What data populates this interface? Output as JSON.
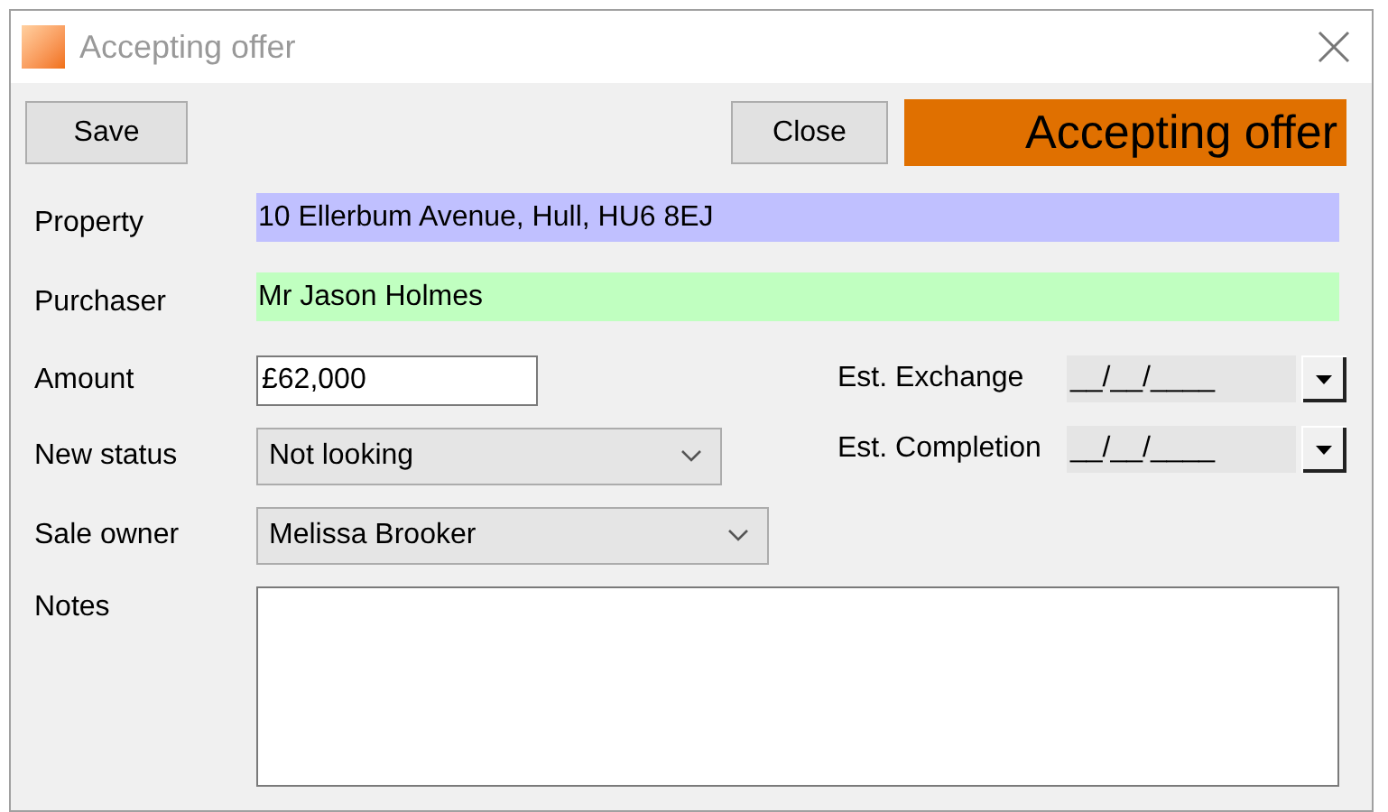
{
  "window": {
    "title": "Accepting offer"
  },
  "buttons": [
    {
      "label": "Save"
    },
    {
      "label": "Close"
    }
  ],
  "status_banner": "Accepting offer",
  "header_fields": [
    {
      "label": "Property",
      "value": "10 Ellerbum Avenue, Hull, HU6 8EJ",
      "color": "#c0c0ff"
    },
    {
      "label": "Purchaser",
      "value": "Mr Jason Holmes",
      "color": "#c0ffc0"
    }
  ],
  "left_fields": [
    {
      "kind": "input",
      "label": "Amount",
      "value": "£62,000"
    },
    {
      "kind": "select",
      "label": "New status",
      "value": "Not looking"
    },
    {
      "kind": "select",
      "label": "Sale owner",
      "value": "Melissa Brooker"
    }
  ],
  "date_fields": [
    {
      "label": "Est. Exchange",
      "value": "__/__/____"
    },
    {
      "label": "Est. Completion",
      "value": "__/__/____"
    }
  ],
  "notes": {
    "label": "Notes"
  }
}
